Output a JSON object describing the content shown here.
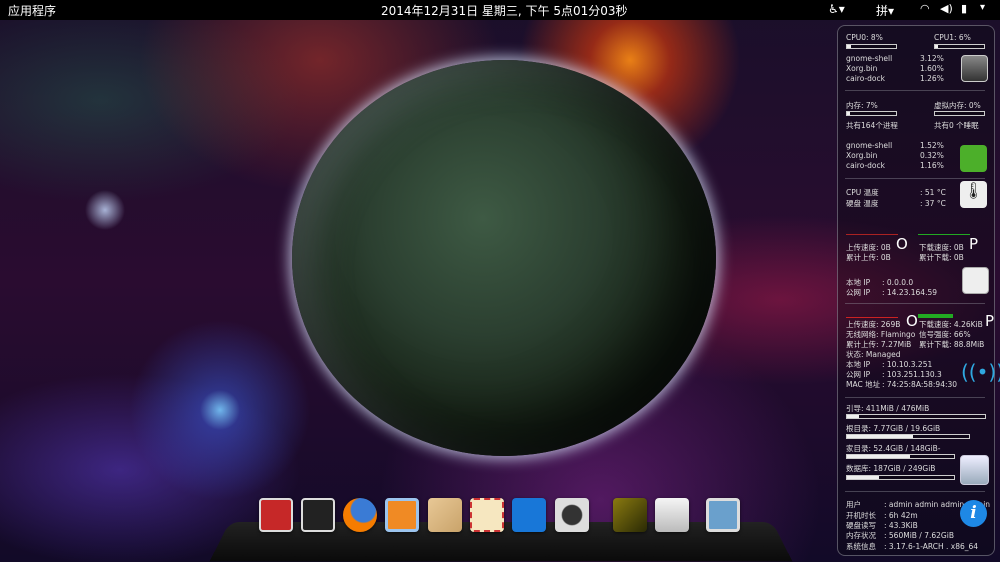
{
  "topbar": {
    "apps": "应用程序",
    "clock": "2014年12月31日 星期三, 下午  5点01分03秒",
    "input_method": "拼"
  },
  "cpu": {
    "cpu0_label": "CPU0: 8%",
    "cpu0": 0.08,
    "cpu1_label": "CPU1: 6%",
    "cpu1": 0.06,
    "procs": [
      {
        "name": "gnome-shell",
        "value": "3.12%"
      },
      {
        "name": "Xorg.bin",
        "value": "1.60%"
      },
      {
        "name": "cairo-dock",
        "value": "1.26%"
      }
    ]
  },
  "mem": {
    "mem_label": "内存: 7%",
    "mem": 0.07,
    "swap_label": "虚拟内存: 0%",
    "swap": 0,
    "procs_total": "共有164个进程",
    "sleeping": "共有0 个睡眠",
    "procs": [
      {
        "name": "gnome-shell",
        "value": "1.52%"
      },
      {
        "name": "Xorg.bin",
        "value": "0.32%"
      },
      {
        "name": "cairo-dock",
        "value": "1.16%"
      }
    ]
  },
  "temp": {
    "cpu_label": "CPU 温度",
    "cpu": ": 51 °C",
    "disk_label": "硬盘 温度",
    "disk": ": 37 °C"
  },
  "wired": {
    "up": "上传速度: 0B",
    "down": "下载速度: 0B",
    "up_total": "累计上传: 0B",
    "down_total": "累计下载: 0B",
    "o": "O",
    "p": "P",
    "local_label": "本地 IP",
    "local": ": 0.0.0.0",
    "public_label": "公网 IP",
    "public": ": 14.23.164.59"
  },
  "wifi": {
    "up": "上传速度: 269B",
    "down": "下载速度: 4.26KiB",
    "o": "O",
    "p": "P",
    "network": "无线网络: Flamingo",
    "signal": "信号强度: 66%",
    "up_total": "累计上传: 7.27MiB",
    "down_total": "累计下载: 88.8MiB",
    "state": "状态: Managed",
    "local_label": "本地 IP",
    "local": ": 10.10.3.251",
    "public_label": "公网 IP",
    "public": ": 103.251.130.3",
    "mac_label": "MAC 地址",
    "mac": ": 74:25:8A:58:94:30"
  },
  "disks": [
    {
      "label": "引导: 411MiB / 476MiB",
      "fill": 0.09
    },
    {
      "label": "根目录: 7.77GiB / 19.6GiB",
      "fill": 0.54
    },
    {
      "label": "家目录: 52.4GiB / 148GiB-",
      "fill": 0.59
    },
    {
      "label": "数据库: 187GiB / 249GiB",
      "fill": 0.3
    }
  ],
  "sys": [
    {
      "label": "用户",
      "value": ": admin admin admin admin"
    },
    {
      "label": "开机时长",
      "value": ": 6h 42m"
    },
    {
      "label": "硬盘读写",
      "value": ": 43.3KiB"
    },
    {
      "label": "内存状况",
      "value": ": 560MiB / 7.62GiB"
    },
    {
      "label": "系统信息",
      "value": ": 3.17.6-1-ARCH . x86_64"
    }
  ],
  "dock": [
    "workspaces",
    "terminal",
    "firefox",
    "virtualbox",
    "paint",
    "mail",
    "teamviewer",
    "camera",
    "image-viewer",
    "file-cabinet",
    "window-manager"
  ],
  "colors": {
    "wifi_icon": "#2fa8e0",
    "info_icon": "#1e88e5"
  }
}
